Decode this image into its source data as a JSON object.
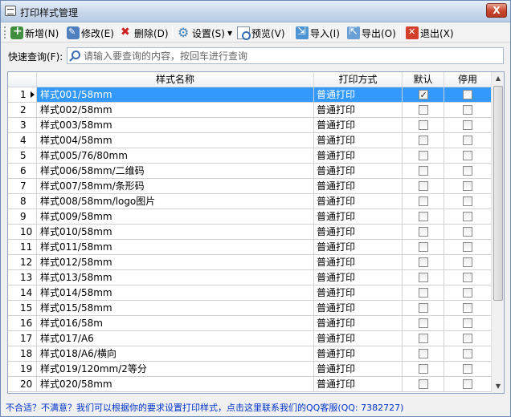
{
  "window": {
    "title": "打印样式管理",
    "close_label": "X"
  },
  "toolbar": {
    "new_label": "新增(N)",
    "edit_label": "修改(E)",
    "delete_label": "删除(D)",
    "settings_label": "设置(S)",
    "preview_label": "预览(V)",
    "import_label": "导入(I)",
    "export_label": "导出(O)",
    "exit_label": "退出(X)"
  },
  "search": {
    "label": "快速查询(F):",
    "placeholder": "请输入要查询的内容，按回车进行查询",
    "value": ""
  },
  "table": {
    "headers": {
      "name": "样式名称",
      "mode": "打印方式",
      "default": "默认",
      "disabled": "停用"
    },
    "rows": [
      {
        "idx": "1",
        "name": "样式001/58mm",
        "mode": "普通打印",
        "default": true,
        "disabled": false,
        "selected": true
      },
      {
        "idx": "2",
        "name": "样式002/58mm",
        "mode": "普通打印",
        "default": false,
        "disabled": false
      },
      {
        "idx": "3",
        "name": "样式003/58mm",
        "mode": "普通打印",
        "default": false,
        "disabled": false
      },
      {
        "idx": "4",
        "name": "样式004/58mm",
        "mode": "普通打印",
        "default": false,
        "disabled": false
      },
      {
        "idx": "5",
        "name": "样式005/76/80mm",
        "mode": "普通打印",
        "default": false,
        "disabled": false
      },
      {
        "idx": "6",
        "name": "样式006/58mm/二维码",
        "mode": "普通打印",
        "default": false,
        "disabled": false
      },
      {
        "idx": "7",
        "name": "样式007/58mm/条形码",
        "mode": "普通打印",
        "default": false,
        "disabled": false
      },
      {
        "idx": "8",
        "name": "样式008/58mm/logo图片",
        "mode": "普通打印",
        "default": false,
        "disabled": false
      },
      {
        "idx": "9",
        "name": "样式009/58mm",
        "mode": "普通打印",
        "default": false,
        "disabled": false
      },
      {
        "idx": "10",
        "name": "样式010/58mm",
        "mode": "普通打印",
        "default": false,
        "disabled": false
      },
      {
        "idx": "11",
        "name": "样式011/58mm",
        "mode": "普通打印",
        "default": false,
        "disabled": false
      },
      {
        "idx": "12",
        "name": "样式012/58mm",
        "mode": "普通打印",
        "default": false,
        "disabled": false
      },
      {
        "idx": "13",
        "name": "样式013/58mm",
        "mode": "普通打印",
        "default": false,
        "disabled": false
      },
      {
        "idx": "14",
        "name": "样式014/58mm",
        "mode": "普通打印",
        "default": false,
        "disabled": false
      },
      {
        "idx": "15",
        "name": "样式015/58mm",
        "mode": "普通打印",
        "default": false,
        "disabled": false
      },
      {
        "idx": "16",
        "name": "样式016/58m",
        "mode": "普通打印",
        "default": false,
        "disabled": false
      },
      {
        "idx": "17",
        "name": "样式017/A6",
        "mode": "普通打印",
        "default": false,
        "disabled": false
      },
      {
        "idx": "18",
        "name": "样式018/A6/横向",
        "mode": "普通打印",
        "default": false,
        "disabled": false
      },
      {
        "idx": "19",
        "name": "样式019/120mm/2等分",
        "mode": "普通打印",
        "default": false,
        "disabled": false
      },
      {
        "idx": "20",
        "name": "样式020/58mm",
        "mode": "普通打印",
        "default": false,
        "disabled": false
      }
    ]
  },
  "footer": {
    "link_text": "不合适？不满意？我们可以根据你的要求设置打印样式，点击这里联系我们的QQ客服(QQ: 7382727)"
  },
  "colors": {
    "selection": "#3399ff",
    "link": "#0033cc",
    "title_bar": "#c9d8ec"
  }
}
